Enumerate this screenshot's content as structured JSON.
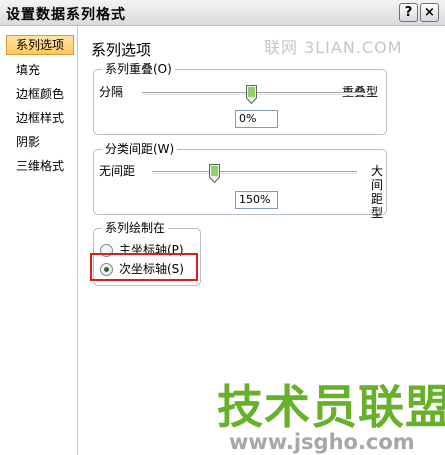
{
  "window": {
    "title": "设置数据系列格式",
    "help_glyph": "?",
    "close_glyph": "×"
  },
  "sidebar": {
    "items": [
      {
        "label": "系列选项",
        "selected": true
      },
      {
        "label": "填充",
        "selected": false
      },
      {
        "label": "边框颜色",
        "selected": false
      },
      {
        "label": "边框样式",
        "selected": false
      },
      {
        "label": "阴影",
        "selected": false
      },
      {
        "label": "三维格式",
        "selected": false
      }
    ]
  },
  "main": {
    "heading": "系列选项",
    "watermark_top": "联网 3LIAN.COM",
    "overlap": {
      "legend": "系列重叠(O)",
      "min_label": "分隔",
      "max_label": "重叠型",
      "value": "0%",
      "level": 0.0
    },
    "gap": {
      "legend": "分类间距(W)",
      "min_label": "无间距",
      "max_label": "大间距型",
      "value": "150%",
      "level": 0.3
    },
    "plot_on": {
      "legend": "系列绘制在",
      "options": [
        {
          "label": "主坐标轴(P)",
          "checked": false
        },
        {
          "label": "次坐标轴(S)",
          "checked": true
        }
      ]
    }
  },
  "watermark": {
    "logo_text": "技术员联盟",
    "url": "www.jsgho.com"
  },
  "colors": {
    "selected_bg": "#ffc85c",
    "highlight_border": "#d8201f",
    "logo_green": "#67b12a"
  }
}
